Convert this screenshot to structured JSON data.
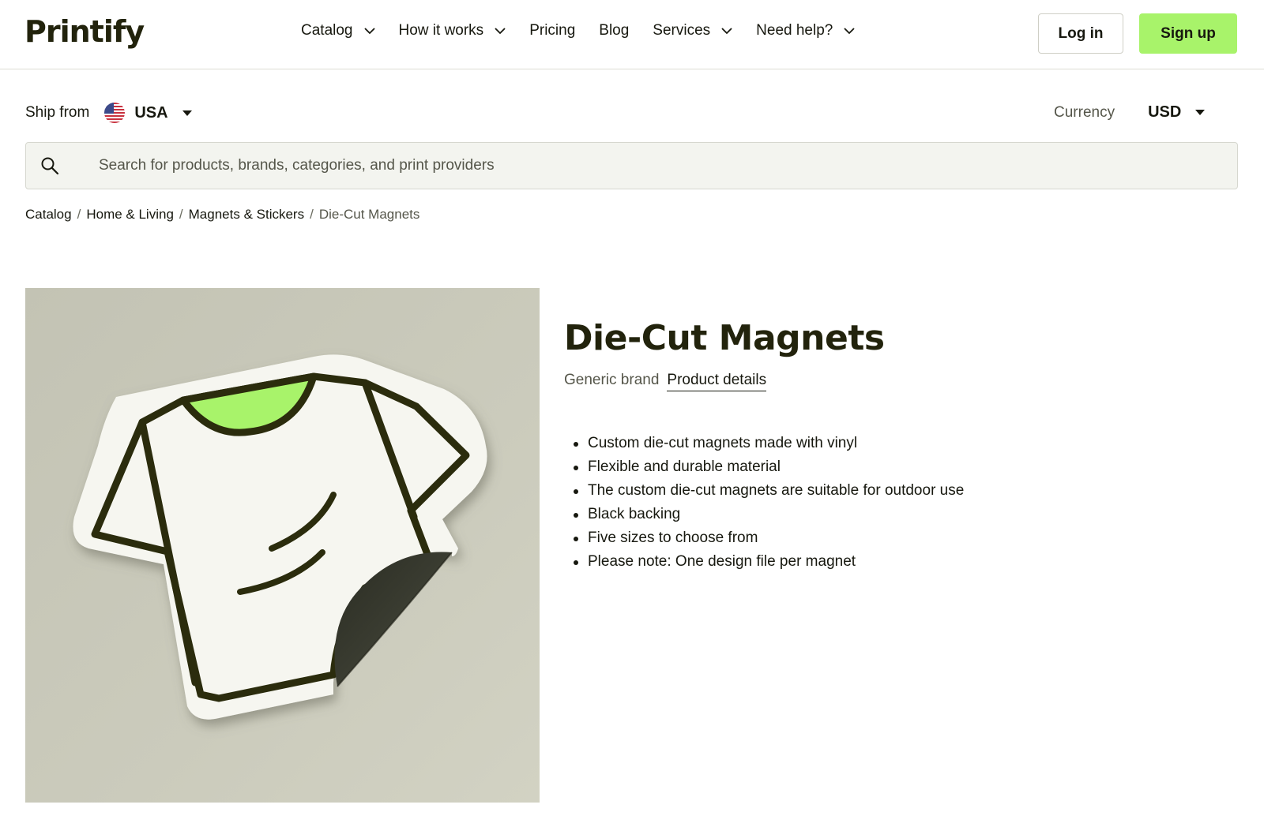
{
  "header": {
    "logo": "Printify",
    "nav": [
      {
        "label": "Catalog",
        "dropdown": true
      },
      {
        "label": "How it works",
        "dropdown": true
      },
      {
        "label": "Pricing",
        "dropdown": false
      },
      {
        "label": "Blog",
        "dropdown": false
      },
      {
        "label": "Services",
        "dropdown": true
      },
      {
        "label": "Need help?",
        "dropdown": true
      }
    ],
    "login_label": "Log in",
    "signup_label": "Sign up"
  },
  "ship": {
    "label": "Ship from",
    "country": "USA",
    "flag_icon": "us-flag-icon"
  },
  "currency": {
    "label": "Currency",
    "value": "USD"
  },
  "search": {
    "placeholder": "Search for products, brands, categories, and print providers",
    "value": ""
  },
  "breadcrumb": [
    {
      "label": "Catalog"
    },
    {
      "label": "Home & Living"
    },
    {
      "label": "Magnets & Stickers"
    },
    {
      "label": "Die-Cut Magnets"
    }
  ],
  "product": {
    "title": "Die-Cut Magnets",
    "brand": "Generic brand",
    "details_link": "Product details",
    "features": [
      "Custom die-cut magnets made with vinyl",
      "Flexible and durable material",
      "The custom die-cut magnets are suitable for outdoor use",
      "Black backing",
      "Five sizes to choose from",
      "Please note: One design file per magnet"
    ]
  },
  "colors": {
    "accent": "#a8f36a",
    "ink": "#22230c",
    "image_bg": "#c8c8b9"
  }
}
